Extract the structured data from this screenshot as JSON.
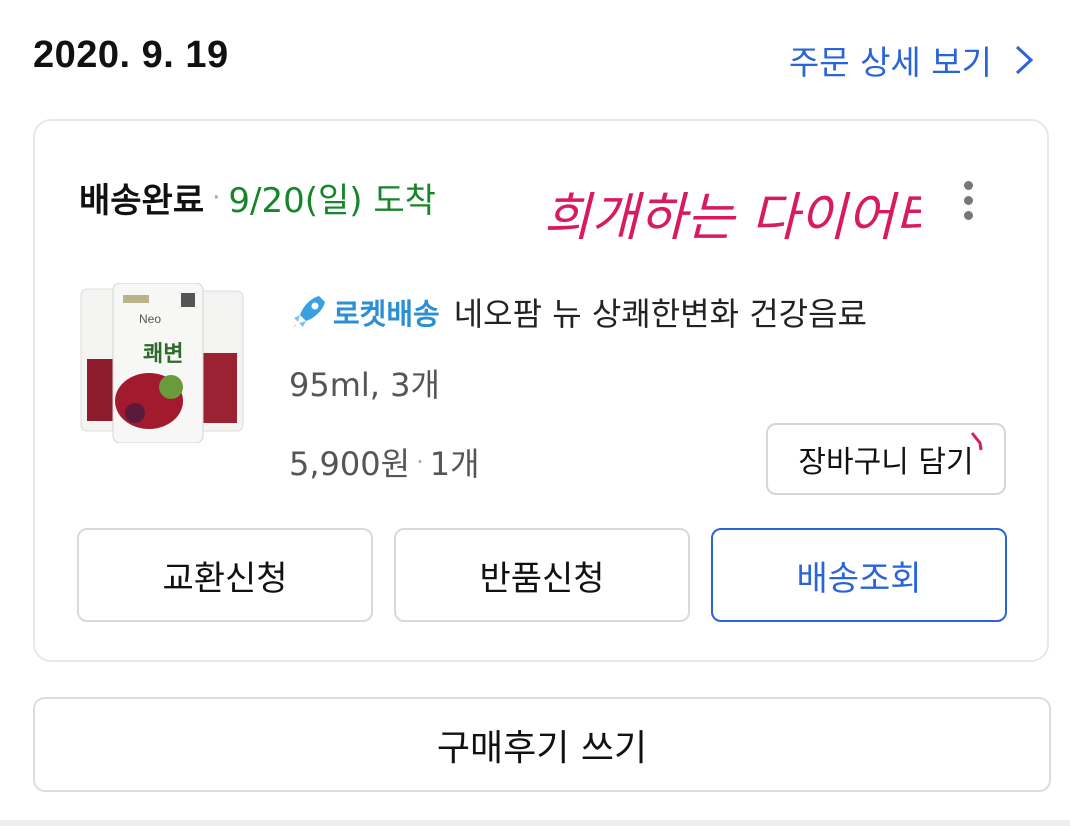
{
  "order": {
    "date": "2020. 9. 19",
    "detail_link": "주문 상세 보기"
  },
  "card": {
    "status": "배송완료",
    "arrival": "9/20(일) 도착",
    "handwritten_note": "희개하는 다이어터",
    "product": {
      "badge": "로켓배송",
      "name": "네오팜 뉴 상쾌한변화 건강음료",
      "option": "95ml, 3개",
      "price": "5,900원",
      "quantity": "1개",
      "thumb_caption": "쾌변",
      "thumb_brand": "Neo"
    },
    "cart_button": "장바구니 담기",
    "actions": {
      "exchange": "교환신청",
      "return": "반품신청",
      "track": "배송조회"
    }
  },
  "review_button": "구매후기 쓰기",
  "colors": {
    "accent_blue": "#2a64d8",
    "arrival_green": "#15862a",
    "rocket_blue": "#2a8fd3",
    "handwriting_pink": "#d81b60"
  }
}
